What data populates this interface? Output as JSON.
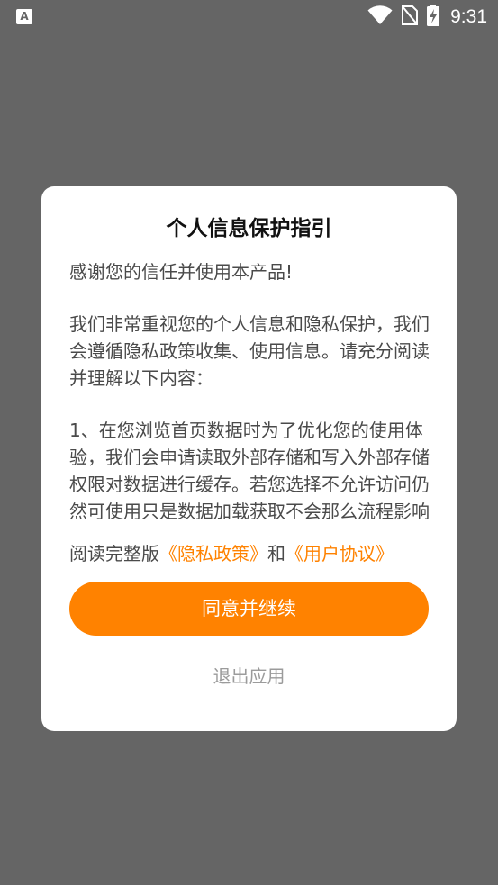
{
  "status_bar": {
    "app_icon_glyph": "A",
    "time": "9:31",
    "icons": [
      "wifi-icon",
      "no-sim-icon",
      "battery-charging-icon"
    ]
  },
  "dialog": {
    "title": "个人信息保护指引",
    "paragraphs": [
      "感谢您的信任并使用本产品!",
      "我们非常重视您的个人信息和隐私保护，我们会遵循隐私政策收集、使用信息。请充分阅读并理解以下内容：",
      "1、在您浏览首页数据时为了优化您的使用体验，我们会申请读取外部存储和写入外部存储权限对数据进行缓存。若您选择不允许访问仍然可使用只是数据加载获取不会那么流程影响体验"
    ],
    "links_prefix": "阅读完整版",
    "privacy_link": "《隐私政策》",
    "links_conjunction": "和",
    "agreement_link": "《用户协议》",
    "agree_button": "同意并继续",
    "exit_button": "退出应用"
  },
  "colors": {
    "accent": "#ff8200",
    "overlay": "#656565",
    "dialog_bg": "#ffffff",
    "body_text": "#4a4a4a",
    "muted_text": "#9b9b9b"
  }
}
